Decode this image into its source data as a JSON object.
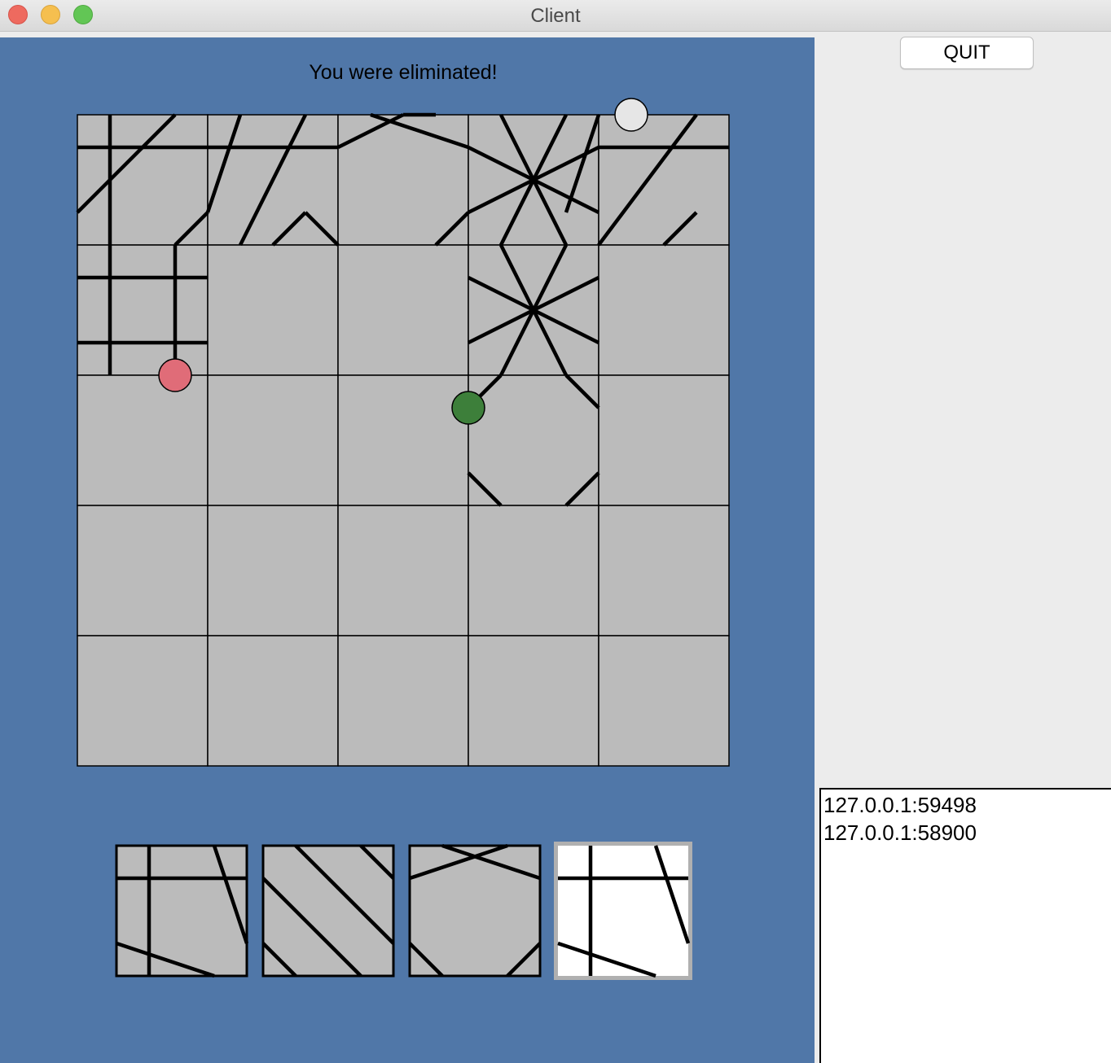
{
  "window": {
    "title": "Client"
  },
  "status_message": "You were eliminated!",
  "quit_label": "QUIT",
  "players": [
    "127.0.0.1:59498",
    "127.0.0.1:58900"
  ],
  "colors": {
    "board_bg": "#5077a8",
    "tile": "#bbbbbb",
    "selected_tile": "#ffffff",
    "player_red": "#e06c78",
    "player_green": "#3d7f3a",
    "player_white": "#e6e6e6"
  },
  "board": {
    "rows": 5,
    "cols": 5
  },
  "tokens": [
    {
      "player": "red"
    },
    {
      "player": "green"
    },
    {
      "player": "white"
    }
  ],
  "hand": {
    "tile_count": 4,
    "selected_index": 3
  }
}
